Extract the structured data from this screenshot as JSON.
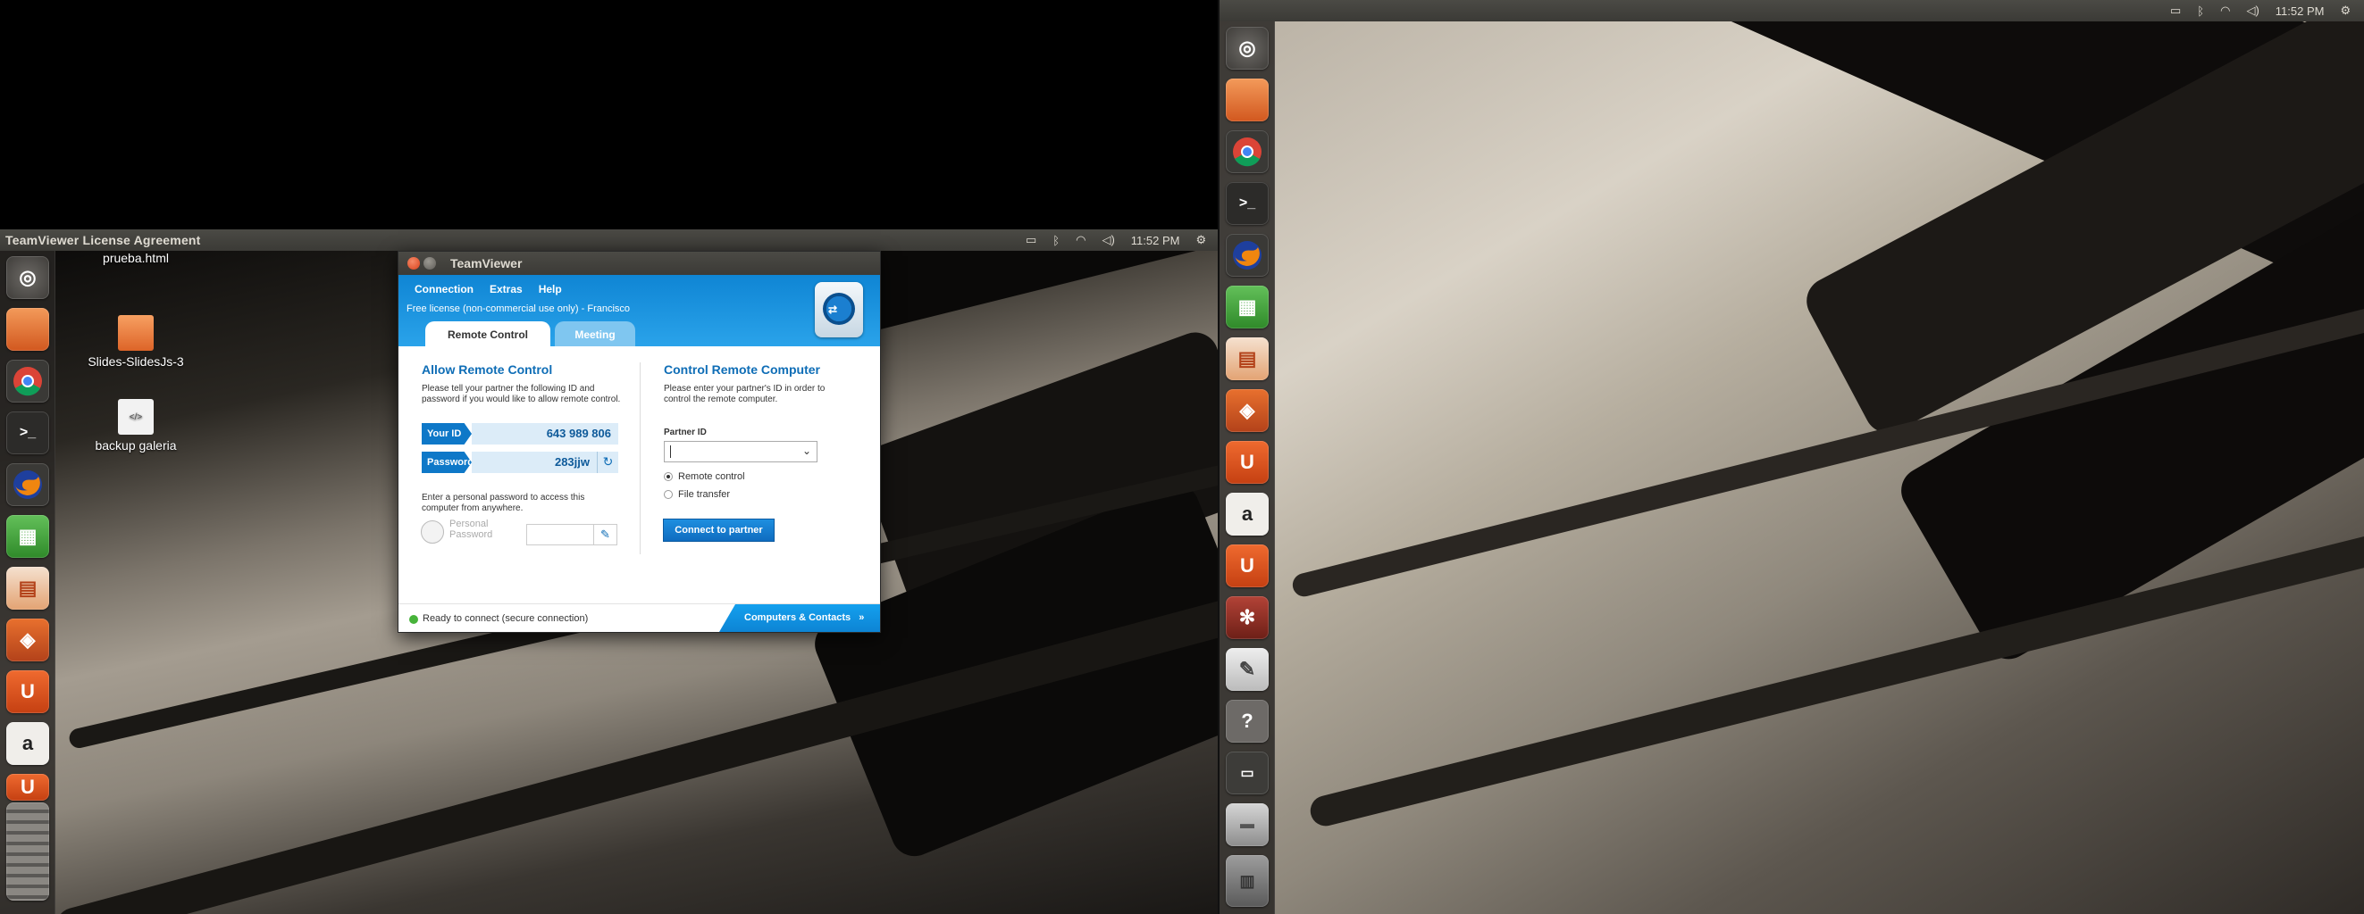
{
  "monitor1": {
    "panel": {
      "window_title": "TeamViewer License Agreement",
      "clock": "11:52 PM"
    },
    "desktop_files": [
      {
        "label": "prueba.html",
        "kind": "doc"
      },
      {
        "label": "Slides-SlidesJs-3",
        "kind": "folder"
      },
      {
        "label": "backup galeria",
        "kind": "doc"
      }
    ]
  },
  "monitor2": {
    "panel": {
      "clock": "11:52 PM"
    }
  },
  "indicators": [
    "battery-icon",
    "bluetooth-icon",
    "wifi-icon",
    "volume-icon",
    "gear-icon"
  ],
  "launcher_items": [
    "dash-home",
    "files",
    "chromium",
    "terminal",
    "firefox",
    "libreoffice-calc",
    "libreoffice-impress",
    "ubuntu-software-center",
    "ubuntu-one",
    "amazon",
    "ubuntu-one-music",
    "system-settings",
    "text-editor",
    "help",
    "dialog",
    "drive",
    "trash"
  ],
  "teamviewer": {
    "title": "TeamViewer",
    "menu": [
      "Connection",
      "Extras",
      "Help"
    ],
    "license": "Free license (non-commercial use only) - Francisco",
    "tabs": {
      "remote_control": "Remote Control",
      "meeting": "Meeting"
    },
    "allow": {
      "title": "Allow Remote Control",
      "description": "Please tell your partner the following ID and password if you would like to allow remote control.",
      "id_label": "Your ID",
      "id_value": "643 989 806",
      "password_label": "Password",
      "password_value": "283jjw",
      "personal_desc": "Enter a personal password to access this computer from anywhere.",
      "personal_label": "Personal Password"
    },
    "control": {
      "title": "Control Remote Computer",
      "description": "Please enter your partner's ID in order to control the remote computer.",
      "partner_label": "Partner ID",
      "partner_value": "",
      "radio_remote": "Remote control",
      "radio_file": "File transfer",
      "connect_label": "Connect to partner"
    },
    "status": "Ready to connect (secure connection)",
    "contacts_label": "Computers & Contacts",
    "contacts_chevron": "»"
  },
  "colors": {
    "teamviewer_blue": "#0e78c8",
    "panel": "#3f3e3a",
    "status_green": "#47b33a"
  }
}
